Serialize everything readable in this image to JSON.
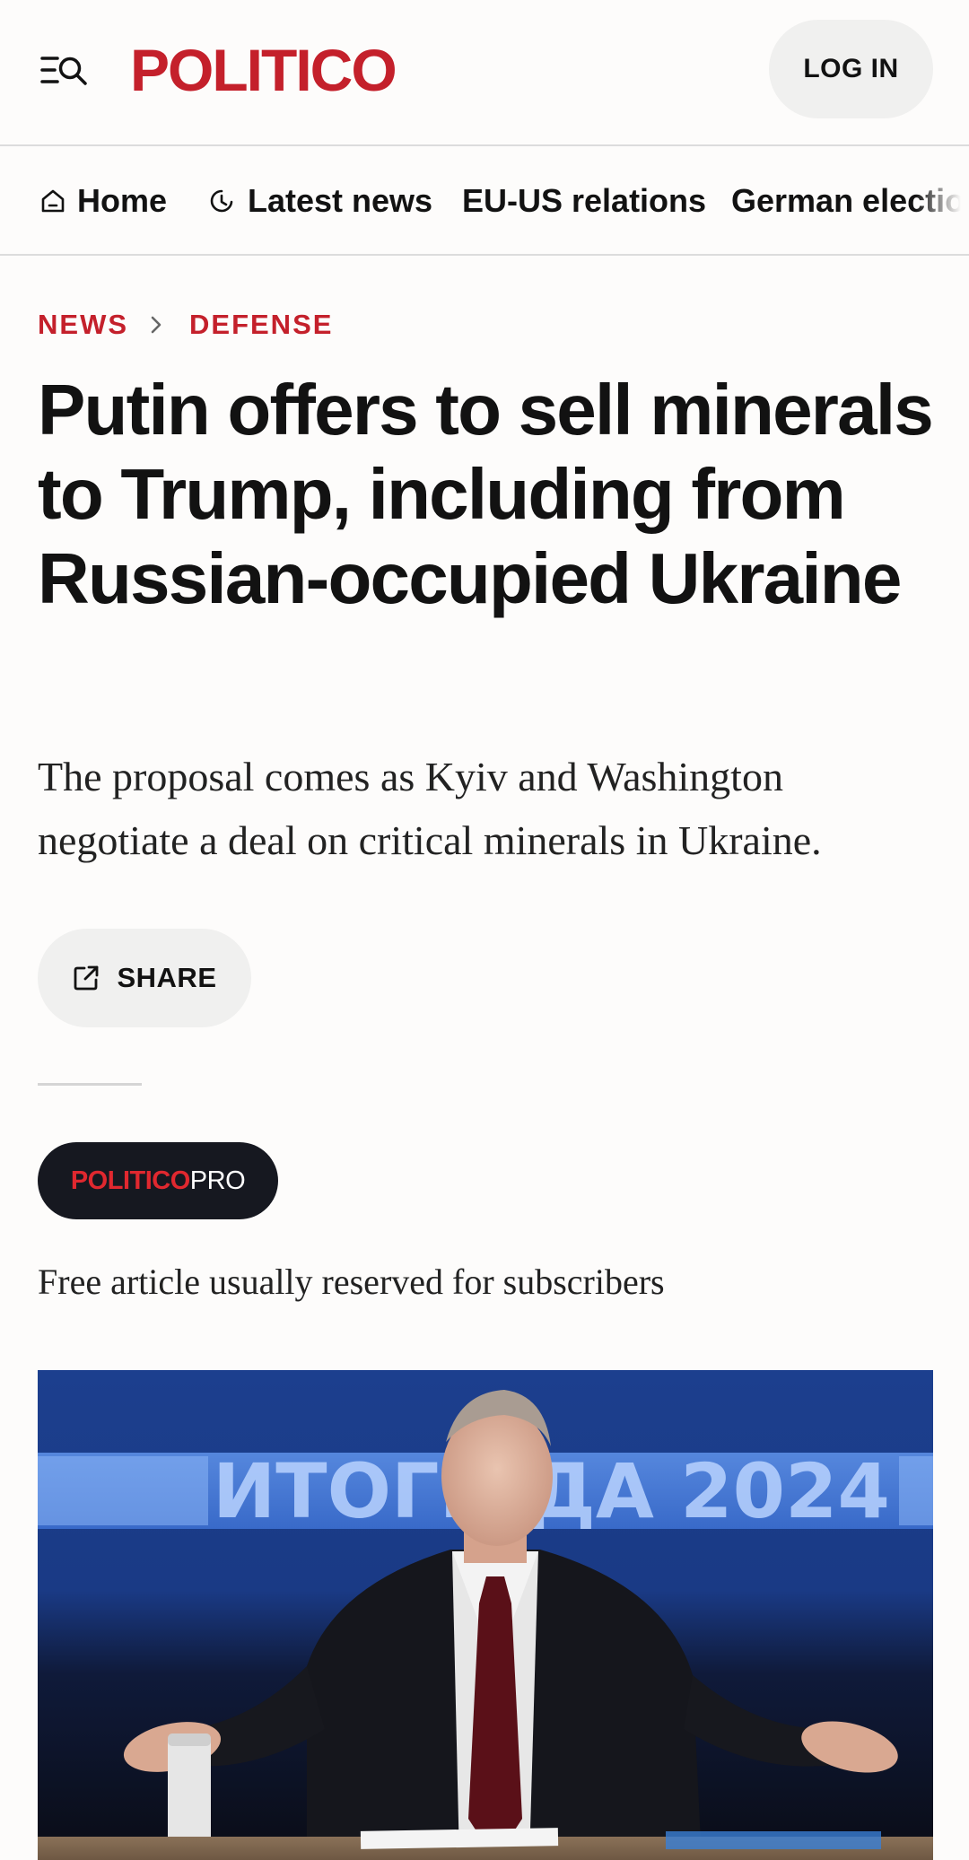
{
  "header": {
    "logo_text": "POLITICO",
    "login_label": "LOG IN",
    "menu_icon": "menu-search-icon"
  },
  "nav": {
    "items": [
      {
        "label": "Home",
        "icon": "home-icon"
      },
      {
        "label": "Latest news",
        "icon": "clock-icon"
      },
      {
        "label": "EU-US relations"
      },
      {
        "label": "German election"
      }
    ]
  },
  "breadcrumb": {
    "items": [
      "NEWS",
      "DEFENSE"
    ]
  },
  "article": {
    "headline": "Putin offers to sell minerals to Trump, including from Russian-occupied Ukraine",
    "dek": "The proposal comes as Kyiv and Washington negotiate a deal on critical minerals in Ukraine.",
    "share_label": "SHARE",
    "pro_badge": {
      "brand": "POLITICO",
      "suffix": "PRO"
    },
    "access_note": "Free article usually reserved for subscribers",
    "image": {
      "backdrop_text": "ИТОГИ  ДА 2024"
    }
  },
  "colors": {
    "brand_red": "#c4202b",
    "text": "#121212",
    "pill_bg": "#f0f0ef",
    "badge_bg": "#161820"
  }
}
